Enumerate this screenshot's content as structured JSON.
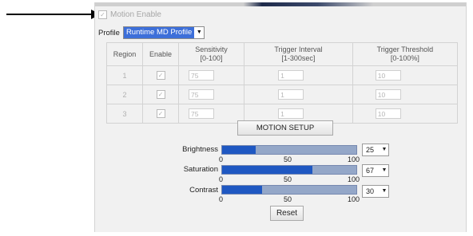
{
  "motion_enable": {
    "label": "Motion Enable",
    "checked": true
  },
  "profile": {
    "label": "Profile",
    "value": "Runtime MD Profile"
  },
  "table": {
    "headers": {
      "region": "Region",
      "enable": "Enable",
      "sensitivity": [
        "Sensitivity",
        "[0-100]"
      ],
      "trigger_interval": [
        "Trigger Interval",
        "[1-300sec]"
      ],
      "trigger_threshold": [
        "Trigger Threshold",
        "[0-100%]"
      ]
    },
    "rows": [
      {
        "region": "1",
        "enabled": true,
        "sensitivity": "75",
        "trigger_interval": "1",
        "trigger_threshold": "10"
      },
      {
        "region": "2",
        "enabled": true,
        "sensitivity": "75",
        "trigger_interval": "1",
        "trigger_threshold": "10"
      },
      {
        "region": "3",
        "enabled": true,
        "sensitivity": "75",
        "trigger_interval": "1",
        "trigger_threshold": "10"
      }
    ]
  },
  "motion_setup_label": "MOTION SETUP",
  "sliders": [
    {
      "label": "Brightness",
      "value": "25",
      "fraction": 0.25
    },
    {
      "label": "Saturation",
      "value": "67",
      "fraction": 0.67
    },
    {
      "label": "Contrast",
      "value": "30",
      "fraction": 0.3
    }
  ],
  "scale_ticks": [
    "0",
    "50",
    "100"
  ],
  "reset_label": "Reset",
  "colors": {
    "highlight": "#3d6fd9",
    "slider_fill": "#1f58c2",
    "slider_track": "#94a7c8"
  }
}
